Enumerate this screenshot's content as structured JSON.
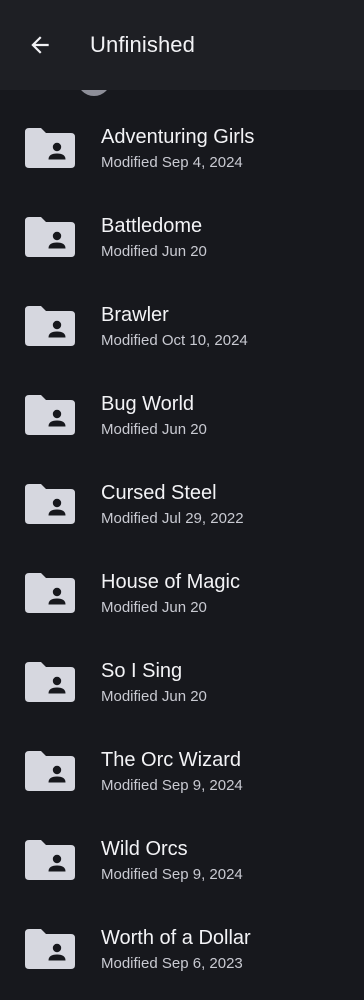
{
  "header": {
    "title": "Unfinished",
    "back_icon": "arrow-back-icon"
  },
  "colors": {
    "background": "#17181d",
    "header": "#1e1f24",
    "folder_icon": "#d6d7df",
    "text_primary": "#f3f3f6",
    "text_secondary": "#c9cad2"
  },
  "items": [
    {
      "name": "Adventuring Girls",
      "modified": "Modified Sep 4, 2024",
      "icon": "shared-folder-icon"
    },
    {
      "name": "Battledome",
      "modified": "Modified Jun 20",
      "icon": "shared-folder-icon"
    },
    {
      "name": "Brawler",
      "modified": "Modified Oct 10, 2024",
      "icon": "shared-folder-icon"
    },
    {
      "name": "Bug World",
      "modified": "Modified Jun 20",
      "icon": "shared-folder-icon"
    },
    {
      "name": "Cursed Steel",
      "modified": "Modified Jul 29, 2022",
      "icon": "shared-folder-icon"
    },
    {
      "name": "House of Magic",
      "modified": "Modified Jun 20",
      "icon": "shared-folder-icon"
    },
    {
      "name": "So I Sing",
      "modified": "Modified Jun 20",
      "icon": "shared-folder-icon"
    },
    {
      "name": "The Orc Wizard",
      "modified": "Modified Sep 9, 2024",
      "icon": "shared-folder-icon"
    },
    {
      "name": "Wild Orcs",
      "modified": "Modified Sep 9, 2024",
      "icon": "shared-folder-icon"
    },
    {
      "name": "Worth of a Dollar",
      "modified": "Modified Sep 6, 2023",
      "icon": "shared-folder-icon"
    }
  ]
}
